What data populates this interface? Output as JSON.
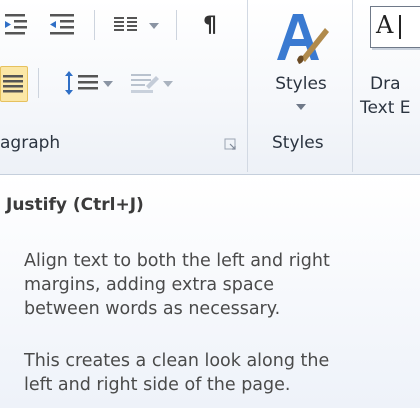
{
  "ribbon": {
    "paragraph_group_label": "agraph",
    "styles_group_label": "Styles",
    "styles_button_label": "Styles",
    "draw_textbox_label_line1": "Dra",
    "draw_textbox_label_line2": "Text E",
    "draw_textbox_icon_text": "A",
    "show_marks_glyph": "¶",
    "icons": {
      "decrease_indent": "decrease-indent-icon",
      "increase_indent": "increase-indent-icon",
      "columns": "columns-icon",
      "paragraph_marks": "pilcrow-icon",
      "justify": "justify-icon",
      "line_spacing": "line-spacing-icon",
      "shading": "shading-icon",
      "dialog_launcher": "dialog-launcher-icon",
      "styles": "styles-icon",
      "dropdown": "chevron-down-icon"
    },
    "colors": {
      "ribbon_bg": "#f6f8fb",
      "accent_blue": "#2f6fc6",
      "text": "#2b3440"
    }
  },
  "tooltip": {
    "title": "Justify (Ctrl+J)",
    "para1": [
      "Align text to both the left and right",
      "margins, adding extra space",
      "between words as necessary."
    ],
    "para2": [
      "This creates a clean look along the",
      "left and right side of the page."
    ]
  }
}
